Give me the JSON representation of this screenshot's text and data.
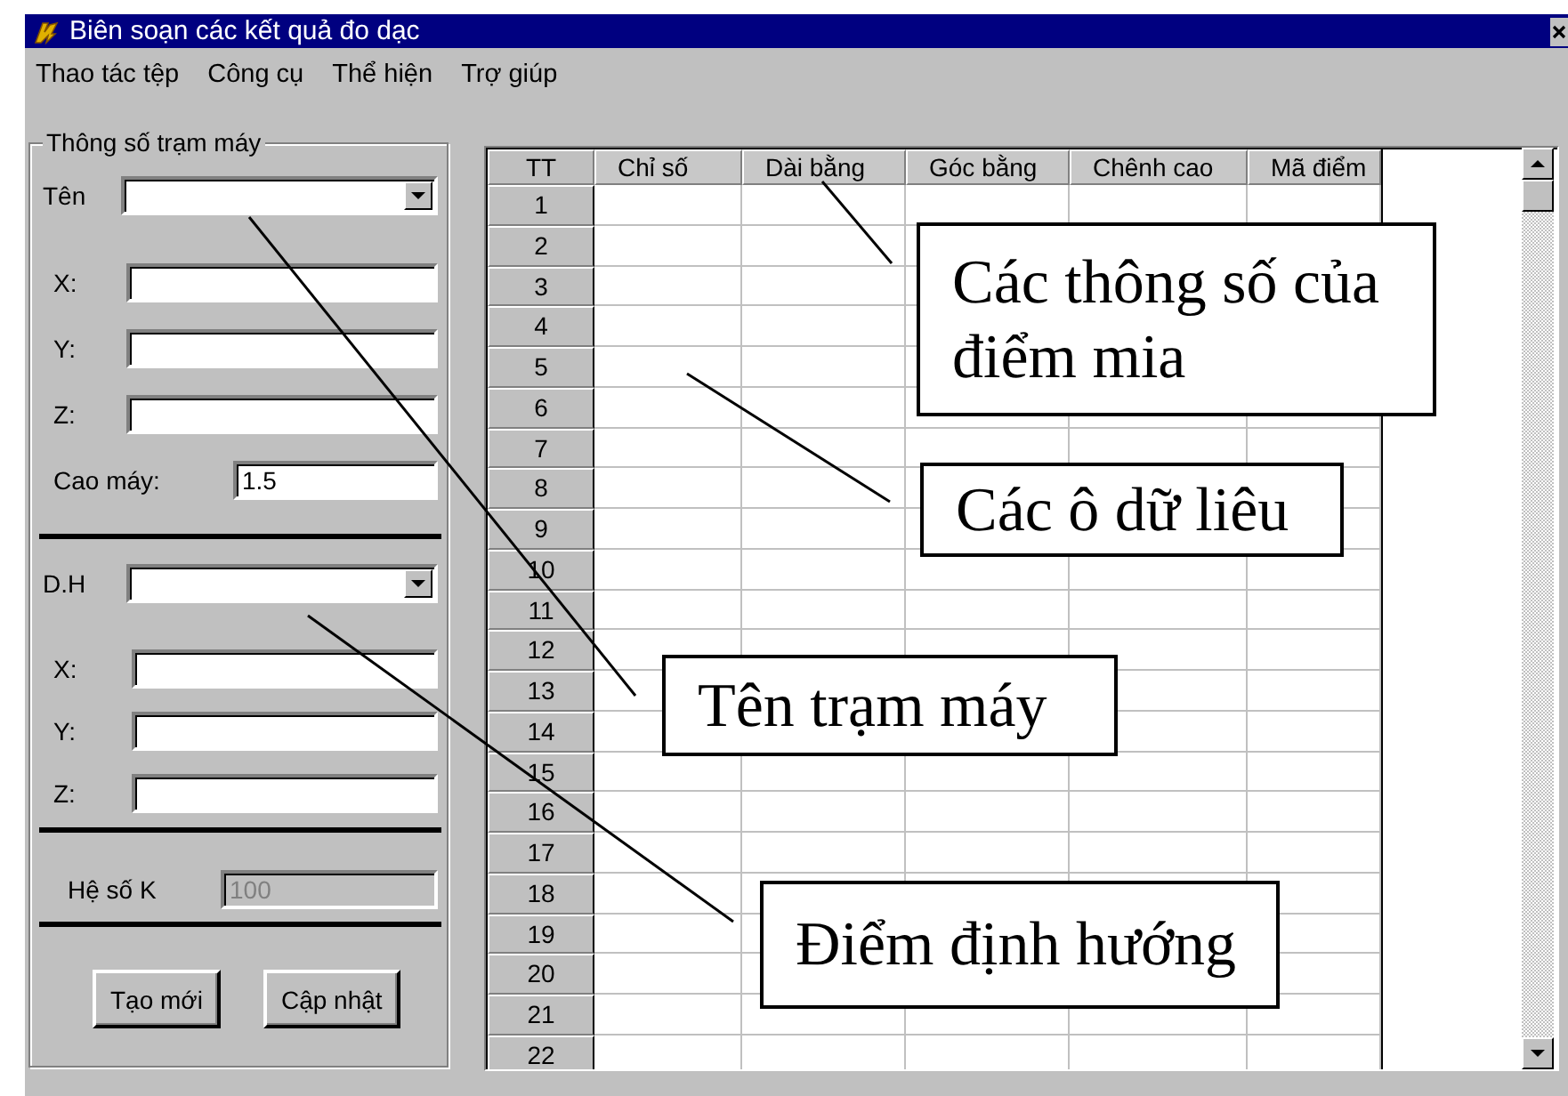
{
  "window": {
    "title": "Biên soạn các kết quả đo dạc"
  },
  "menu": [
    "Thao tác tệp",
    "Công cụ",
    "Thể hiện",
    "Trợ giúp"
  ],
  "station_group": {
    "legend": "Thông số trạm máy",
    "sections": [
      {
        "fields": [
          {
            "kind": "combo",
            "label": "Tên"
          },
          {
            "kind": "text",
            "label": "X:"
          },
          {
            "kind": "text",
            "label": "Y:"
          },
          {
            "kind": "text",
            "label": "Z:"
          },
          {
            "kind": "text",
            "label": "Cao máy:",
            "value": "1.5",
            "disabled": false
          }
        ]
      },
      {
        "fields": [
          {
            "kind": "combo",
            "label": "D.H"
          },
          {
            "kind": "text",
            "label": "X:"
          },
          {
            "kind": "text",
            "label": "Y:"
          },
          {
            "kind": "text",
            "label": "Z:"
          }
        ]
      },
      {
        "fields": [
          {
            "kind": "text",
            "label": "Hệ số K",
            "value": "100",
            "disabled": true
          }
        ]
      }
    ]
  },
  "buttons": [
    "Tạo mới",
    "Cập nhật"
  ],
  "table": {
    "columns": [
      "TT",
      "Chỉ số",
      "Dài bằng",
      "Góc bằng",
      "Chênh cao",
      "Mã điểm"
    ],
    "rows": [
      "1",
      "2",
      "3",
      "4",
      "5",
      "6",
      "7",
      "8",
      "9",
      "10",
      "11",
      "12",
      "13",
      "14",
      "15",
      "16",
      "17",
      "18",
      "19",
      "20",
      "21",
      "22"
    ]
  },
  "callouts": [
    "Các thông số của điểm mia",
    "Các ô dữ liêu",
    "Tên trạm máy",
    "Điểm định hướng"
  ]
}
